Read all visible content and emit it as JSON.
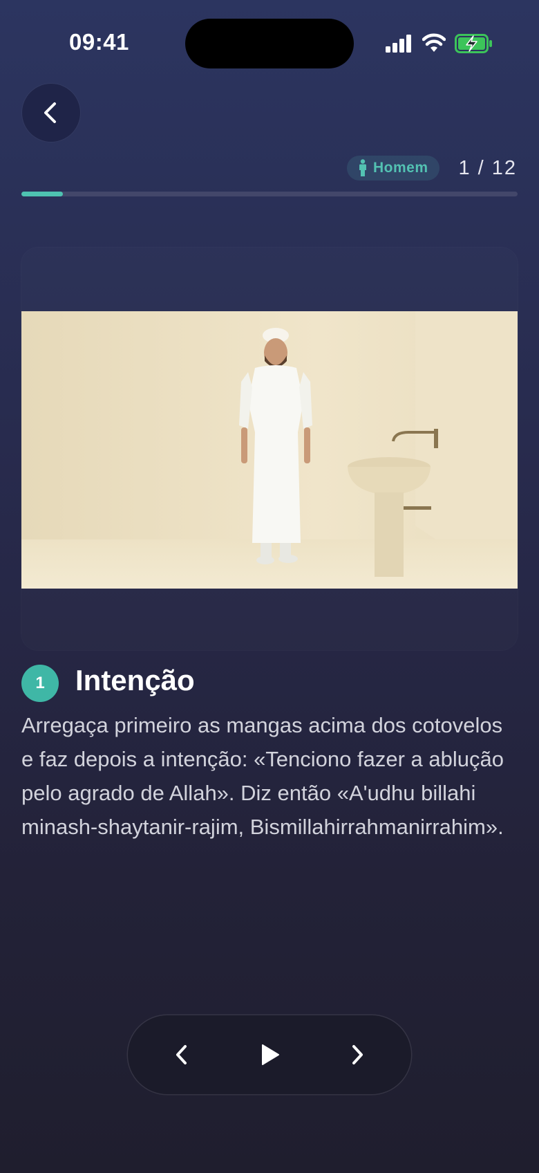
{
  "status_bar": {
    "time": "09:41"
  },
  "header": {
    "back_icon": "chevron-left-icon",
    "gender_badge": {
      "icon": "person-icon",
      "label": "Homem",
      "color": "#53c2b2"
    },
    "step_counter": "1 / 12",
    "progress": {
      "current": 1,
      "total": 12,
      "fraction": 0.0833,
      "color": "#4ec2b1"
    }
  },
  "illustration": {
    "alt": "Homem de pé ao lado de um lavatório"
  },
  "step": {
    "number": "1",
    "title": "Intenção",
    "description": "Arregaça primeiro as mangas acima dos cotovelos e faz depois a intenção: «Tenciono fazer a ablução pelo agrado de Allah». Diz então «A'udhu billahi minash-shaytanir-rajim, Bismillahirrahmanirrahim»."
  },
  "player": {
    "prev_icon": "chevron-left-icon",
    "play_icon": "play-icon",
    "next_icon": "chevron-right-icon"
  },
  "colors": {
    "accent": "#3fb7a6",
    "background": "#27294a"
  }
}
